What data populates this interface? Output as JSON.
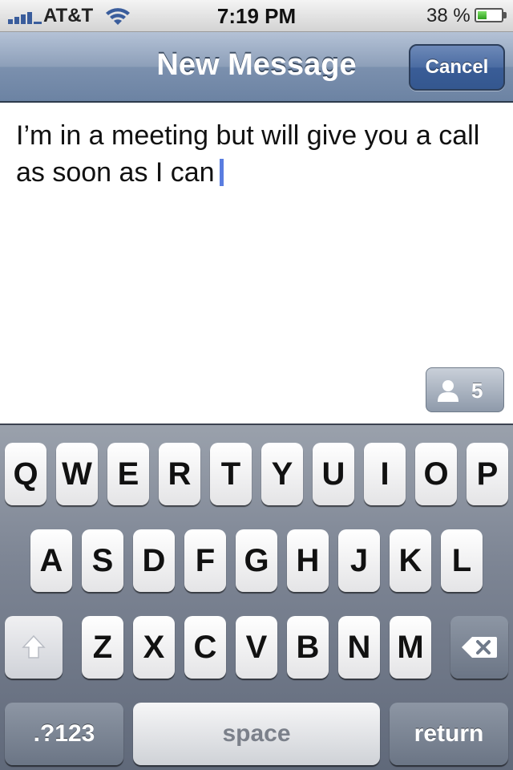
{
  "status_bar": {
    "carrier": "AT&T",
    "time": "7:19 PM",
    "battery_percent": "38 %",
    "battery_level": 0.38,
    "signal_icon": "signal-bars-icon",
    "wifi_icon": "wifi-icon",
    "battery_icon": "battery-icon"
  },
  "nav_bar": {
    "title": "New Message",
    "cancel_label": "Cancel"
  },
  "message": {
    "text": "I’m in a meeting but will give you a call as soon as I can",
    "cursor_color": "#5a7de0"
  },
  "recipients": {
    "icon": "person-icon",
    "count": "5"
  },
  "keyboard": {
    "row1": [
      "Q",
      "W",
      "E",
      "R",
      "T",
      "Y",
      "U",
      "I",
      "O",
      "P"
    ],
    "row2": [
      "A",
      "S",
      "D",
      "F",
      "G",
      "H",
      "J",
      "K",
      "L"
    ],
    "row3": [
      "Z",
      "X",
      "C",
      "V",
      "B",
      "N",
      "M"
    ],
    "shift_icon": "shift-arrow-icon",
    "delete_icon": "backspace-icon",
    "numbers_label": ".?123",
    "space_label": "space",
    "return_label": "return"
  }
}
